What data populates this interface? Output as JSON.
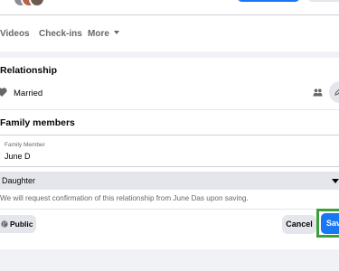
{
  "tabs": {
    "videos": "Videos",
    "checkins": "Check-ins",
    "more": "More"
  },
  "relationship": {
    "title": "Relationship",
    "status": "Married"
  },
  "family": {
    "title": "Family members",
    "field_label": "Family Member",
    "field_value": "June D",
    "relation_value": "Daughter",
    "confirm_text": "We will request confirmation of this relationship from June Das upon saving."
  },
  "actions": {
    "privacy_label": "Public",
    "cancel_label": "Cancel",
    "save_label": "Save"
  },
  "colors": {
    "accent": "#1877f2",
    "highlight": "#3aa13a"
  },
  "icons": {
    "relationship": "heart-icon",
    "audience": "people-icon",
    "edit": "pencil-icon",
    "privacy": "globe-icon"
  }
}
